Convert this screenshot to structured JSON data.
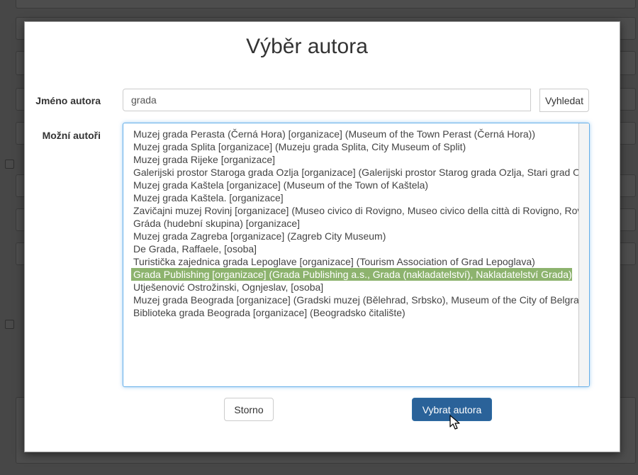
{
  "dialog": {
    "title": "Výběr autora",
    "name_label": "Jméno autora",
    "name_value": "grada",
    "search_label": "Vyhledat",
    "authors_label": "Možní autoři",
    "authors": [
      "Muzej grada Perasta (Černá Hora) [organizace] (Museum of the Town Perast (Černá Hora))",
      "Muzej grada Splita [organizace] (Muzeju grada Splita, City Museum of Split)",
      "Muzej grada Rijeke [organizace]",
      "Galerijski prostor Staroga grada Ozlja [organizace] (Galerijski prostor Starog grada Ozlja, Stari grad Ozalj)",
      "Muzej grada Kaštela [organizace] (Museum of the Town of Kaštela)",
      "Muzej grada Kaštela. [organizace]",
      "Zavičajni muzej Rovinj [organizace] (Museo civico di Rovigno, Museo civico della città di Rovigno, Rovinj)",
      "Gráda (hudební skupina) [organizace]",
      "Muzej grada Zagreba [organizace] (Zagreb City Museum)",
      "De Grada, Raffaele, [osoba]",
      "Turistička zajednica grada Lepoglave [organizace] (Tourism Association of Grad Lepoglava)",
      "Grada Publishing [organizace] (Grada Publishing a.s., Grada (nakladatelství), Nakladatelství Grada)",
      "Utješenović Ostrožinski, Ognjeslav, [osoba]",
      "Muzej grada Beograda [organizace] (Gradski muzej (Bělehrad, Srbsko), Museum of the City of Belgrade)",
      "Biblioteka grada Beograda [organizace] (Beogradsko čitalište)"
    ],
    "selected_index": 11,
    "cancel_label": "Storno",
    "select_label": "Vybrat autora"
  },
  "colors": {
    "selection": "#8db36e",
    "primary_button": "#2a6299",
    "focus_border": "#66afe9"
  },
  "icons": {
    "cursor": "mouse-pointer-icon"
  }
}
